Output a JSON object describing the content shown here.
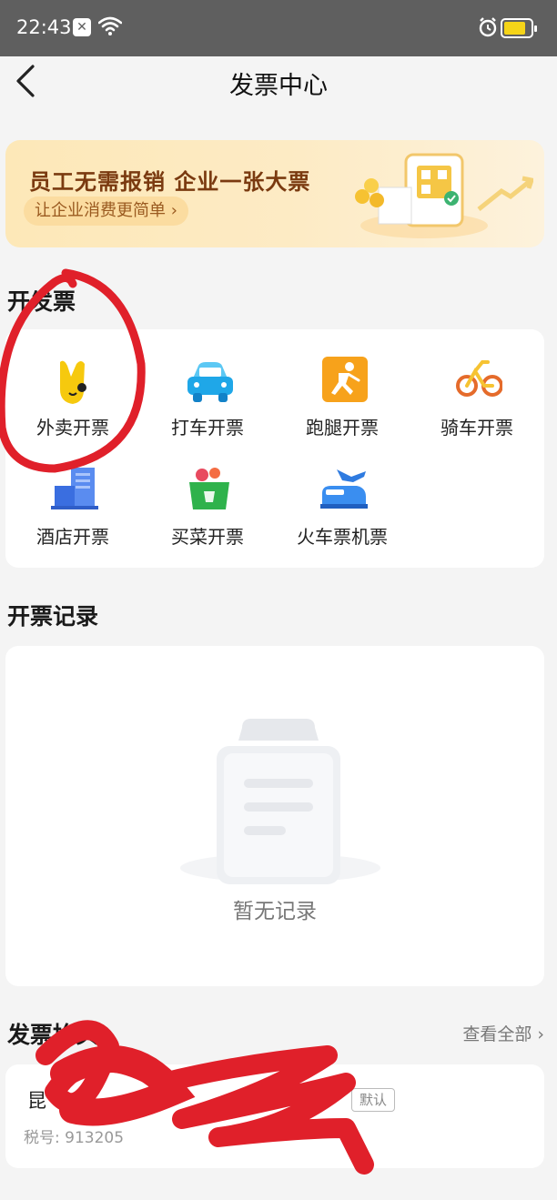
{
  "status_bar": {
    "time": "22:43",
    "sim_icon": "sim-x-icon",
    "wifi_icon": "wifi-icon",
    "alarm_icon": "alarm-icon",
    "battery_icon": "battery-icon"
  },
  "nav": {
    "title": "发票中心",
    "back_icon": "chevron-left-icon"
  },
  "banner": {
    "headline": "员工无需报销 企业一张大票",
    "sub": "让企业消费更简单 ›"
  },
  "issue_section": {
    "title": "开发票",
    "items": [
      {
        "label": "外卖开票",
        "icon": "takeout-icon"
      },
      {
        "label": "打车开票",
        "icon": "car-icon"
      },
      {
        "label": "跑腿开票",
        "icon": "runner-icon"
      },
      {
        "label": "骑车开票",
        "icon": "bike-icon"
      },
      {
        "label": "酒店开票",
        "icon": "hotel-icon"
      },
      {
        "label": "买菜开票",
        "icon": "grocery-icon"
      },
      {
        "label": "火车票机票",
        "icon": "plane-train-icon"
      }
    ]
  },
  "records_section": {
    "title": "开票记录",
    "empty_text": "暂无记录"
  },
  "headers_section": {
    "title": "发票抬头",
    "view_all": "查看全部 ›",
    "entry": {
      "name": "昆",
      "default_badge": "默认",
      "tax_id": "税号: 913205"
    }
  },
  "colors": {
    "accent": "#f7c21c",
    "annotation": "#e0202a",
    "banner_text": "#7a3a10"
  }
}
